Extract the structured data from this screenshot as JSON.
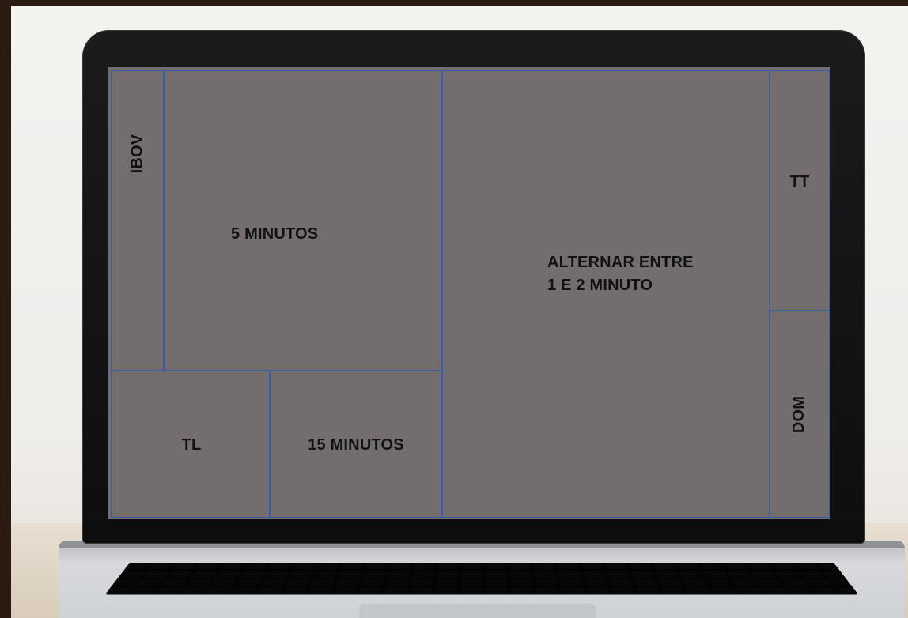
{
  "layout_diagram": {
    "panels": [
      {
        "id": "ibov",
        "label": "IBOV"
      },
      {
        "id": "five-min",
        "label": "5 MINUTOS"
      },
      {
        "id": "alternate",
        "label_lines": [
          "ALTERNAR ENTRE",
          "1 E 2 MINUTO"
        ]
      },
      {
        "id": "tt",
        "label": "TT"
      },
      {
        "id": "dom",
        "label": "DOM"
      },
      {
        "id": "tl",
        "label": "TL"
      },
      {
        "id": "fifteen-min",
        "label": "15 MINUTOS"
      }
    ]
  },
  "colors": {
    "panel_fill": "#736e6d",
    "panel_border": "#3a5fa8",
    "label_text": "#111111",
    "bezel": "#0e0e0f"
  }
}
